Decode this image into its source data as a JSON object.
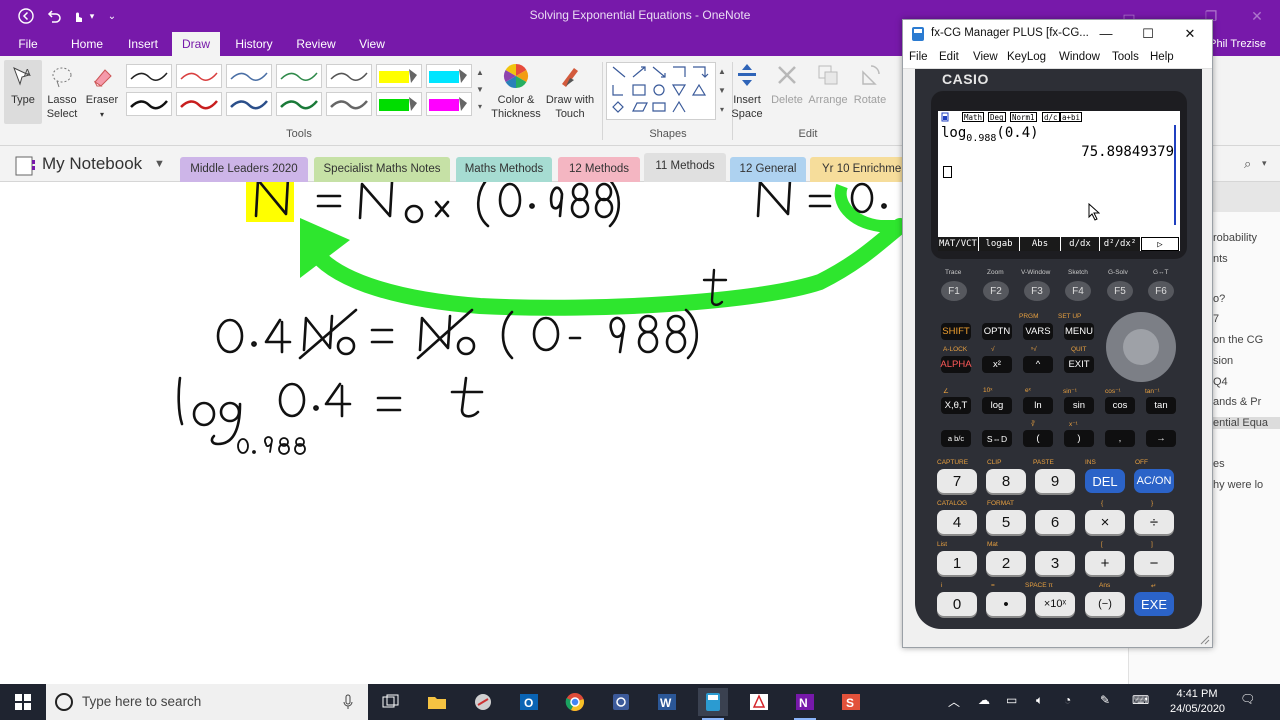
{
  "window": {
    "title": "Solving Exponential Equations - OneNote",
    "user": "Phil Trezise"
  },
  "ribbon_tabs": [
    "File",
    "Home",
    "Insert",
    "Draw",
    "History",
    "Review",
    "View"
  ],
  "active_tab": "Draw",
  "ribbon": {
    "type_label": "Type",
    "lasso_label_1": "Lasso",
    "lasso_label_2": "Select",
    "eraser_label": "Eraser",
    "color_label_1": "Color &",
    "color_label_2": "Thickness",
    "drawtouch_label_1": "Draw with",
    "drawtouch_label_2": "Touch",
    "insert_space_1": "Insert",
    "insert_space_2": "Space",
    "delete_label": "Delete",
    "arrange_label": "Arrange",
    "rotate_label": "Rotate",
    "group_tools": "Tools",
    "group_shapes": "Shapes",
    "group_edit": "Edit",
    "pen_colors": [
      "#222222",
      "#d94040",
      "#4a6fa5",
      "#2f8a4a",
      "#555555",
      "#ffff00",
      "#00e5ff",
      "#111111",
      "#c81e1e",
      "#2b4f8a",
      "#1a7a38",
      "#666666",
      "#00dd00",
      "#ff00ff"
    ]
  },
  "notebook": {
    "name": "My Notebook",
    "sections": [
      {
        "label": "Middle Leaders 2020",
        "color": "#cdb5e8"
      },
      {
        "label": "Specialist Maths Notes",
        "color": "#c6e1a6"
      },
      {
        "label": "Maths Methods",
        "color": "#a6dcd2"
      },
      {
        "label": "12 Methods",
        "color": "#f4b6c2"
      },
      {
        "label": "11 Methods",
        "color": "#e0e0e0"
      },
      {
        "label": "12 General",
        "color": "#aed2f0"
      },
      {
        "label": "Yr 10 Enrichmen",
        "color": "#f6dd9b"
      }
    ]
  },
  "right_panel": {
    "items": [
      "robability",
      "nts",
      "o?",
      "7",
      "on the CG",
      "sion",
      "Q4",
      "ands & Pr",
      "ential Equa",
      "es",
      "hy were lo"
    ]
  },
  "calculator": {
    "window_title": "fx-CG Manager PLUS [fx-CG...",
    "menu": [
      "File",
      "Edit",
      "View",
      "KeyLog",
      "Window",
      "Tools",
      "Help"
    ],
    "brand": "CASIO",
    "status": [
      "Math",
      "Deg",
      "Norm1",
      "d/c",
      "a+bi"
    ],
    "expression_base": "log",
    "expression_sub": "0.988",
    "expression_arg": "(0.4)",
    "result": "75.89849379",
    "fkeys": [
      "MAT/VCT",
      "logab",
      "Abs",
      "d/dx",
      "d²/dx²",
      "▷"
    ],
    "fkey_labels": [
      "F1",
      "F2",
      "F3",
      "F4",
      "F5",
      "F6"
    ],
    "fkey_tops": [
      "Trace",
      "Zoom",
      "V-Window",
      "Sketch",
      "G-Solv",
      "G↔T"
    ],
    "row1": [
      "SHIFT",
      "OPTN",
      "VARS",
      "MENU"
    ],
    "row1_tops": [
      "",
      "",
      "PRGM",
      "SET UP"
    ],
    "row2": [
      "ALPHA",
      "x²",
      "^",
      "EXIT"
    ],
    "row2_tops": [
      "A-LOCK",
      "√",
      "ˣ√",
      "QUIT"
    ],
    "row3": [
      "X,θ,T",
      "log",
      "ln",
      "sin",
      "cos",
      "tan"
    ],
    "row3_tops": [
      "∠",
      "10ˣ",
      "eˣ",
      "sin⁻¹",
      "cos⁻¹",
      "tan⁻¹"
    ],
    "row4": [
      "a b/c",
      "S⇔D",
      "(",
      ")",
      ",",
      "→"
    ],
    "row4_tops": [
      "",
      "",
      "∛",
      "x⁻¹",
      "",
      ""
    ],
    "num_rows": [
      {
        "keys": [
          "7",
          "8",
          "9",
          "DEL",
          "AC/ON"
        ],
        "tops": [
          "CAPTURE",
          "CLIP",
          "PASTE",
          "INS",
          "OFF"
        ]
      },
      {
        "keys": [
          "4",
          "5",
          "6",
          "×",
          "÷"
        ],
        "tops": [
          "CATALOG",
          "FORMAT",
          "",
          "{",
          "}"
        ]
      },
      {
        "keys": [
          "1",
          "2",
          "3",
          "+",
          "−"
        ],
        "tops": [
          "List",
          "Mat",
          "",
          "[",
          "]"
        ]
      },
      {
        "keys": [
          "0",
          "•",
          "×10ˣ",
          "(−)",
          "EXE"
        ],
        "tops": [
          "i",
          "=",
          "SPACE  π",
          "Ans",
          "↵"
        ]
      }
    ]
  },
  "taskbar": {
    "search_placeholder": "Type here to search",
    "time": "4:41 PM",
    "date": "24/05/2020"
  }
}
